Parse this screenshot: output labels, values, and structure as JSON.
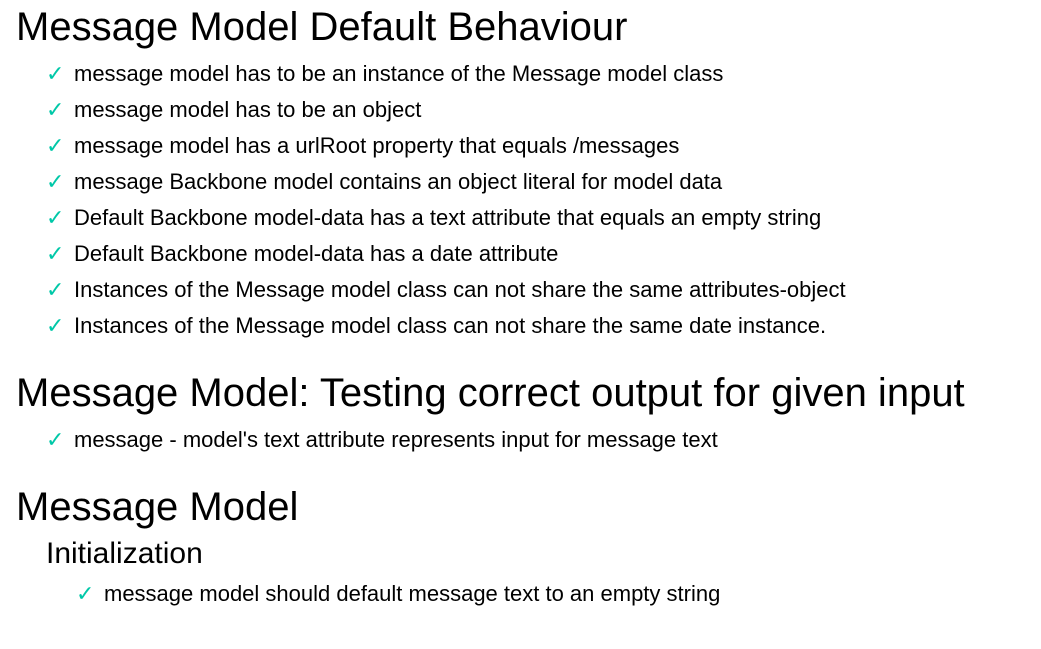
{
  "colors": {
    "pass_check": "#00c8a8",
    "text": "#000000",
    "background": "#ffffff"
  },
  "icons": {
    "pass": "check-icon",
    "pass_glyph": "✓"
  },
  "suites": [
    {
      "title": "Message Model Default Behaviour",
      "tests": [
        "message model has to be an instance of the Message model class",
        "message model has to be an object",
        "message model has a urlRoot property that equals /messages",
        "message Backbone model contains an object literal for model data",
        "Default Backbone model-data has a text attribute that equals an empty string",
        "Default Backbone model-data has a date attribute",
        "Instances of the Message model class can not share the same attributes-object",
        "Instances of the Message model class can not share the same date instance."
      ]
    },
    {
      "title": "Message Model: Testing correct output for given input",
      "tests": [
        "message - model's text attribute represents input for message text"
      ]
    },
    {
      "title": "Message Model",
      "subsuites": [
        {
          "title": "Initialization",
          "tests": [
            "message model should default message text to an empty string"
          ]
        }
      ]
    }
  ]
}
